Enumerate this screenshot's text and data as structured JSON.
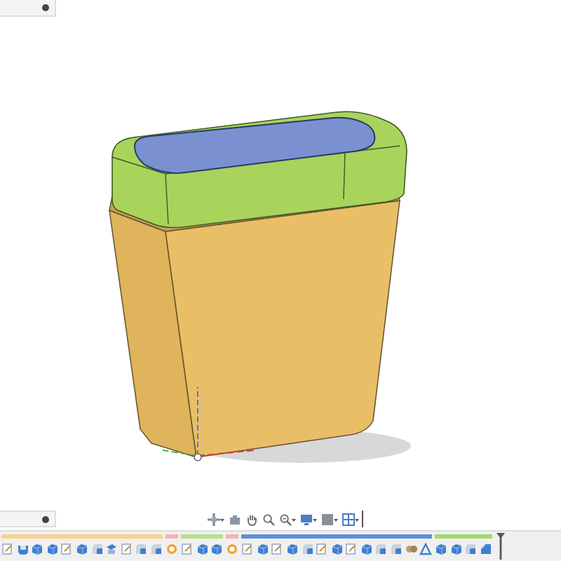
{
  "timeline": {
    "groups": [
      {
        "color": "#f6d38e",
        "features": [
          {
            "kind": "sketch"
          },
          {
            "kind": "shell"
          },
          {
            "kind": "extrude"
          },
          {
            "kind": "extrude"
          },
          {
            "kind": "sketch"
          },
          {
            "kind": "extrude"
          },
          {
            "kind": "fillet"
          },
          {
            "kind": "plane"
          },
          {
            "kind": "sketch"
          },
          {
            "kind": "fillet"
          },
          {
            "kind": "fillet"
          }
        ]
      },
      {
        "color": "#f3b4b4",
        "features": [
          {
            "kind": "combine"
          }
        ]
      },
      {
        "color": "#b6e08c",
        "features": [
          {
            "kind": "sketch"
          },
          {
            "kind": "extrude"
          },
          {
            "kind": "extrude"
          }
        ]
      },
      {
        "color": "#f3b4b4",
        "features": [
          {
            "kind": "combine"
          }
        ]
      },
      {
        "color": "#5d8fd8",
        "features": [
          {
            "kind": "sketch"
          },
          {
            "kind": "extrude"
          },
          {
            "kind": "sketch"
          },
          {
            "kind": "extrude"
          },
          {
            "kind": "fillet"
          },
          {
            "kind": "sketch"
          },
          {
            "kind": "extrude"
          },
          {
            "kind": "sketch"
          },
          {
            "kind": "extrude"
          },
          {
            "kind": "fillet"
          },
          {
            "kind": "fillet"
          },
          {
            "kind": "pattern"
          },
          {
            "kind": "draft"
          }
        ]
      },
      {
        "color": "#a2d96c",
        "features": [
          {
            "kind": "extrude"
          },
          {
            "kind": "extrude"
          },
          {
            "kind": "fillet"
          },
          {
            "kind": "chamfer"
          }
        ]
      }
    ]
  }
}
